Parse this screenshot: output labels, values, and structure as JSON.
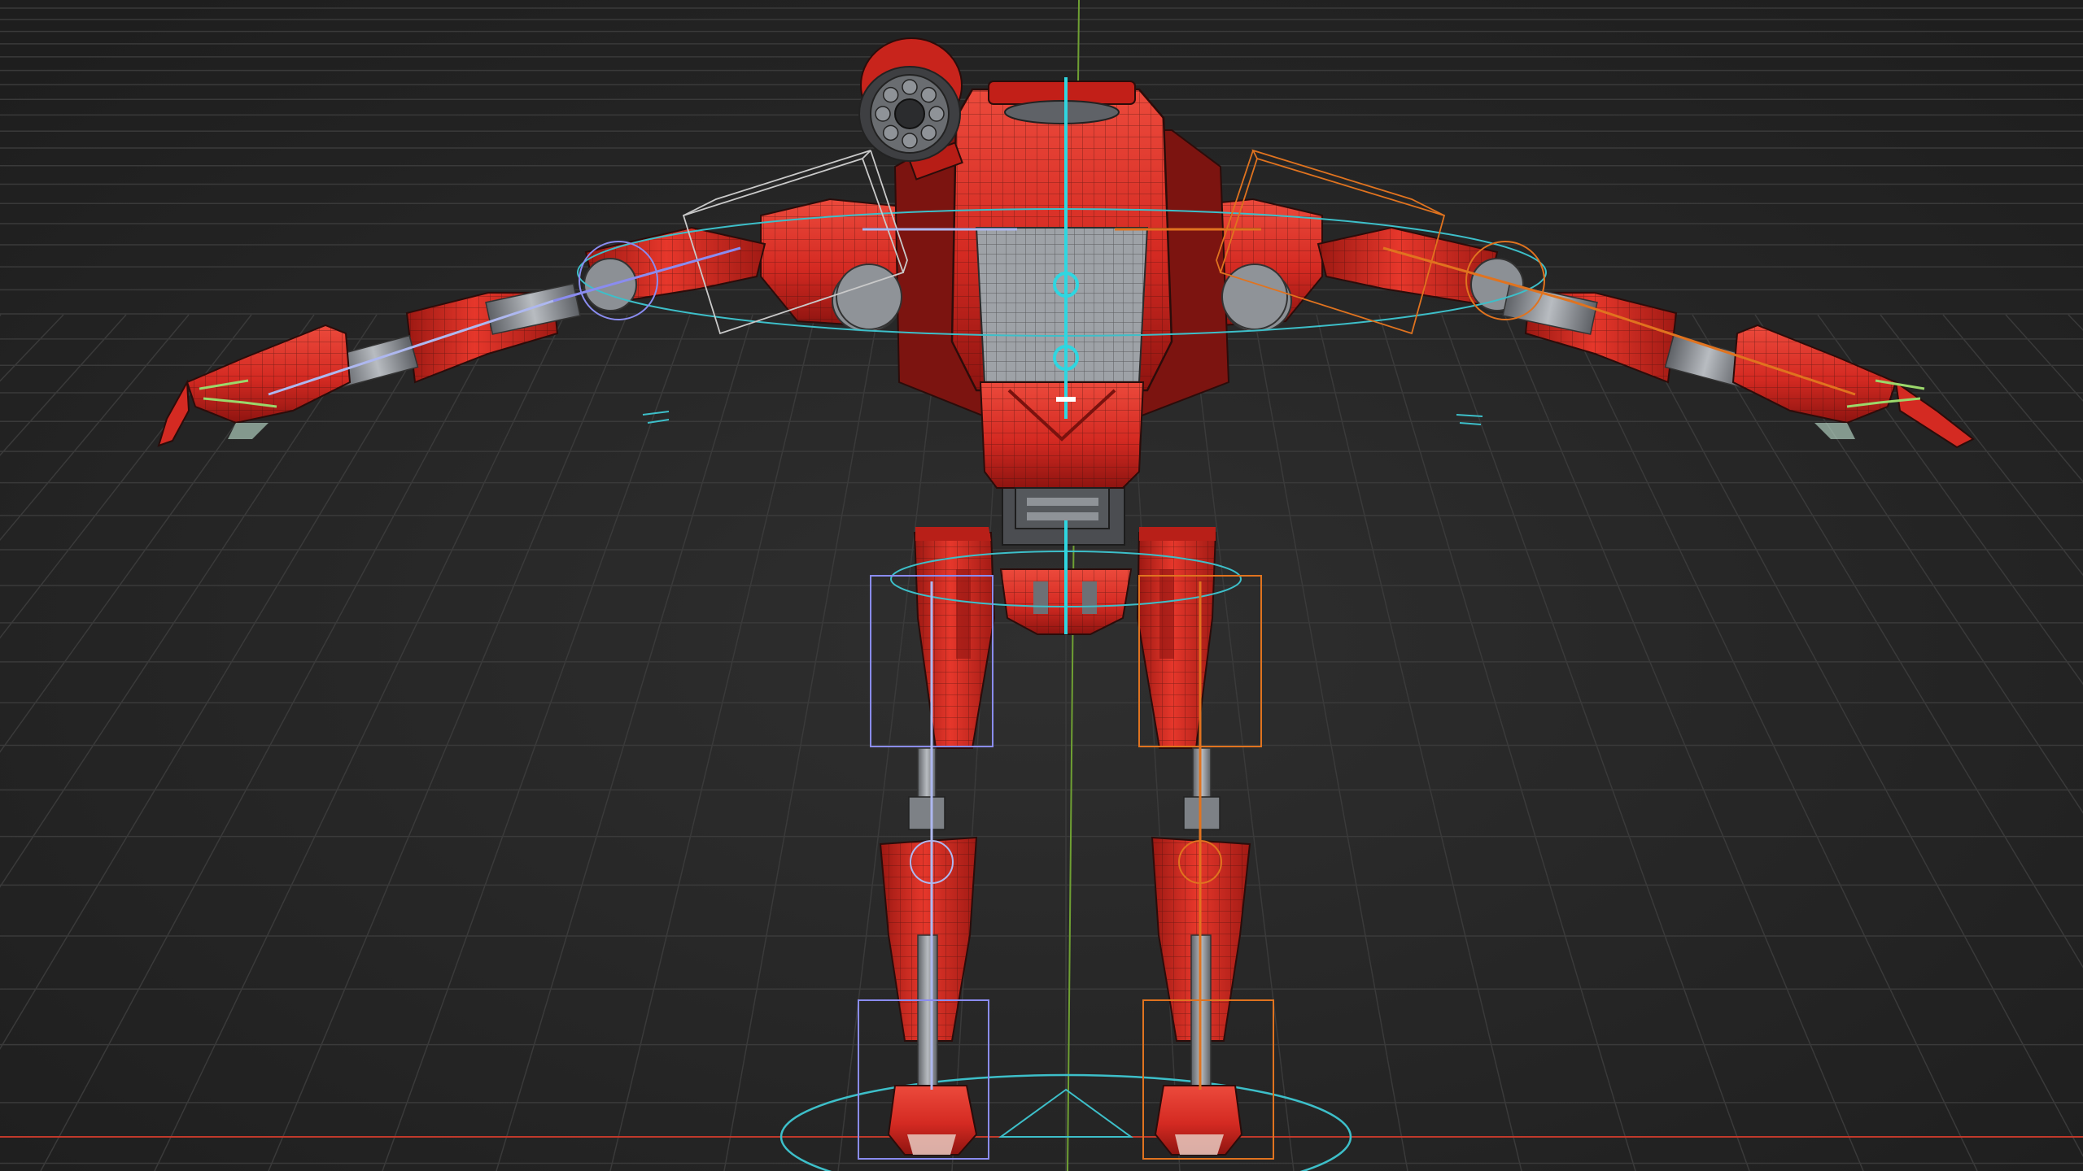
{
  "viewport": {
    "mode": "wireframe-overlay",
    "background": "#262626",
    "grid_color": "#3a3a3a",
    "x_axis_color": "#c0392b",
    "y_axis_color": "#6fa033"
  },
  "model": {
    "subject": "red-robot-rig",
    "pose": "T-pose",
    "body_color": "#d42a22",
    "body_dark": "#8e1410",
    "metal_color": "#8f9398",
    "wire_color": "#2b0c0a"
  },
  "rig": {
    "spine_color": "#2fd6e0",
    "left_side_color": "#8a8cf0",
    "right_side_color": "#e0731f",
    "control_color": "#3dbfc9",
    "finger_color": "#9bd86b"
  }
}
